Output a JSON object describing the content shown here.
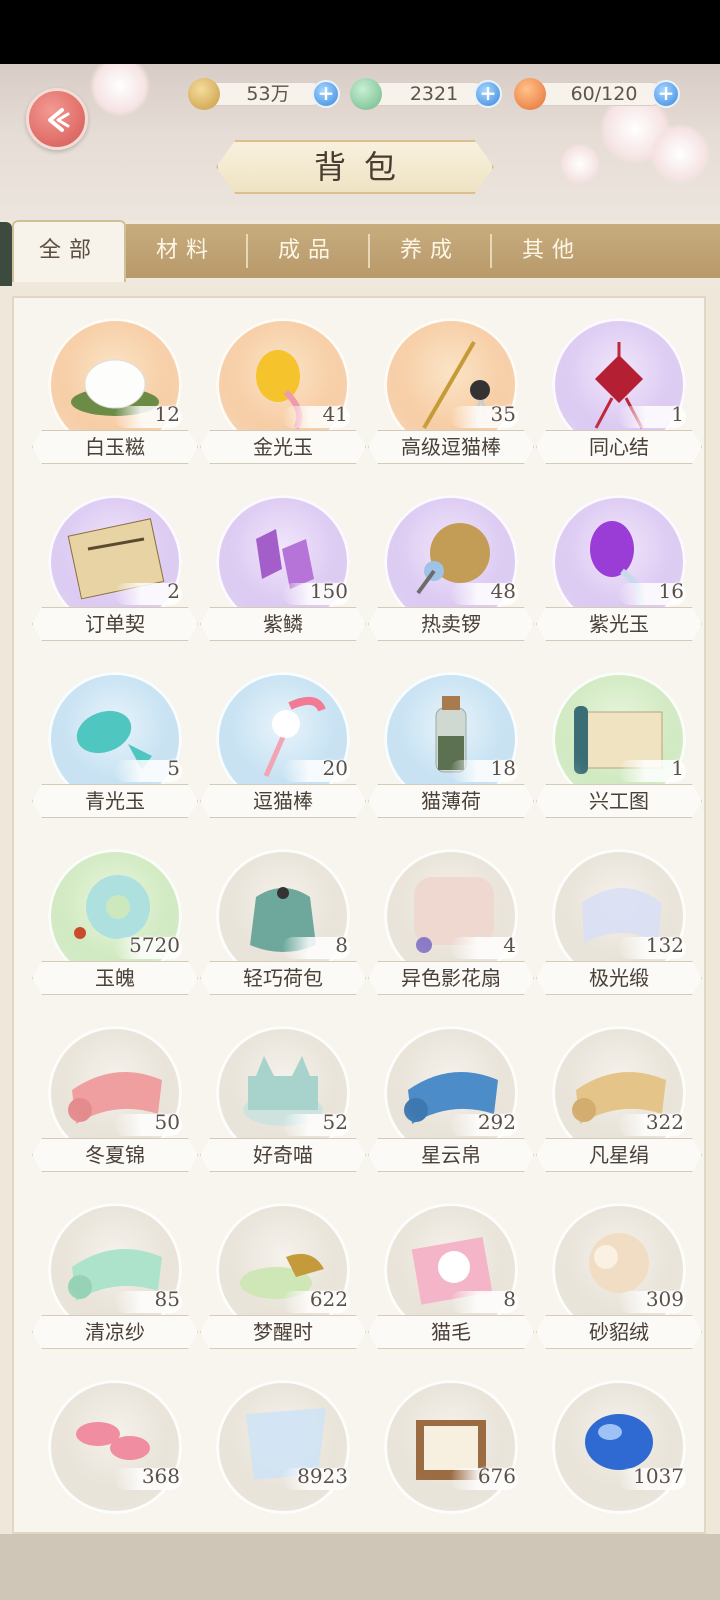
{
  "header": {
    "title": "背包",
    "currencies": [
      {
        "name": "coin-icon",
        "value": "53万",
        "color": "#d6ad5a"
      },
      {
        "name": "jade-icon",
        "value": "2321",
        "color": "#8fd0a8"
      },
      {
        "name": "stamina-icon",
        "value": "60/120",
        "color": "#f2894c"
      }
    ]
  },
  "tabs": [
    {
      "label": "全部",
      "active": true
    },
    {
      "label": "材料",
      "active": false
    },
    {
      "label": "成品",
      "active": false
    },
    {
      "label": "养成",
      "active": false
    },
    {
      "label": "其他",
      "active": false
    }
  ],
  "items": [
    {
      "name": "白玉糍",
      "count": "12",
      "bg": "orange",
      "icon": "rice-cake-icon"
    },
    {
      "name": "金光玉",
      "count": "41",
      "bg": "orange",
      "icon": "gold-fish-icon"
    },
    {
      "name": "高级逗猫棒",
      "count": "35",
      "bg": "orange",
      "icon": "cat-teaser-icon"
    },
    {
      "name": "同心结",
      "count": "1",
      "bg": "purple",
      "icon": "knot-icon"
    },
    {
      "name": "订单契",
      "count": "2",
      "bg": "purple",
      "icon": "contract-icon"
    },
    {
      "name": "紫鳞",
      "count": "150",
      "bg": "purple",
      "icon": "purple-scale-icon"
    },
    {
      "name": "热卖锣",
      "count": "48",
      "bg": "purple",
      "icon": "gong-icon"
    },
    {
      "name": "紫光玉",
      "count": "16",
      "bg": "purple",
      "icon": "purple-fish-icon"
    },
    {
      "name": "青光玉",
      "count": "5",
      "bg": "blue",
      "icon": "teal-fish-icon"
    },
    {
      "name": "逗猫棒",
      "count": "20",
      "bg": "blue",
      "icon": "feather-wand-icon"
    },
    {
      "name": "猫薄荷",
      "count": "18",
      "bg": "blue",
      "icon": "catnip-bottle-icon"
    },
    {
      "name": "兴工图",
      "count": "1",
      "bg": "green",
      "icon": "scroll-icon"
    },
    {
      "name": "玉魄",
      "count": "5720",
      "bg": "green",
      "icon": "jade-ring-icon"
    },
    {
      "name": "轻巧荷包",
      "count": "8",
      "bg": "grey",
      "icon": "pouch-icon"
    },
    {
      "name": "异色影花扇",
      "count": "4",
      "bg": "grey",
      "icon": "fan-icon"
    },
    {
      "name": "极光缎",
      "count": "132",
      "bg": "grey",
      "icon": "silk-icon"
    },
    {
      "name": "冬夏锦",
      "count": "50",
      "bg": "grey",
      "icon": "pink-cloth-icon"
    },
    {
      "name": "好奇喵",
      "count": "52",
      "bg": "grey",
      "icon": "cat-box-icon"
    },
    {
      "name": "星云帛",
      "count": "292",
      "bg": "grey",
      "icon": "blue-cloth-icon"
    },
    {
      "name": "凡星绢",
      "count": "322",
      "bg": "grey",
      "icon": "gold-cloth-icon"
    },
    {
      "name": "清凉纱",
      "count": "85",
      "bg": "grey",
      "icon": "mint-cloth-icon"
    },
    {
      "name": "梦醒时",
      "count": "622",
      "bg": "grey",
      "icon": "powder-box-icon"
    },
    {
      "name": "猫毛",
      "count": "8",
      "bg": "grey",
      "icon": "cat-fur-icon"
    },
    {
      "name": "砂貂绒",
      "count": "309",
      "bg": "grey",
      "icon": "fluff-icon"
    },
    {
      "name": "",
      "count": "368",
      "bg": "grey",
      "icon": "pink-mushroom-icon"
    },
    {
      "name": "",
      "count": "8923",
      "bg": "grey",
      "icon": "veil-icon"
    },
    {
      "name": "",
      "count": "676",
      "bg": "grey",
      "icon": "wood-tray-icon"
    },
    {
      "name": "",
      "count": "1037",
      "bg": "grey",
      "icon": "blue-gem-icon"
    }
  ]
}
